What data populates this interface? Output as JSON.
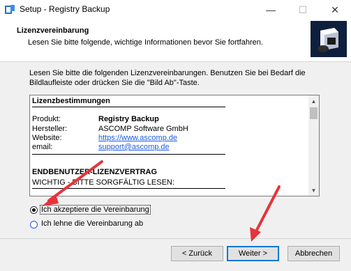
{
  "window": {
    "title": "Setup - Registry Backup",
    "minimize": "—",
    "maximize": "☐",
    "close": "✕"
  },
  "header": {
    "title": "Lizenzvereinbarung",
    "subtitle": "Lesen Sie bitte folgende, wichtige Informationen bevor Sie fortfahren."
  },
  "instructions": {
    "line1": "Lesen Sie bitte die folgenden Lizenzvereinbarungen. Benutzen Sie bei Bedarf die",
    "line2": "Bildlaufleiste oder drücken Sie die \"Bild Ab\"-Taste."
  },
  "license": {
    "heading": "Lizenzbestimmungen",
    "fields": [
      {
        "label": "Produkt:",
        "value": "Registry Backup",
        "bold": true
      },
      {
        "label": "Hersteller:",
        "value": "ASCOMP Software GmbH"
      },
      {
        "label": "Website:",
        "value": "https://www.ascomp.de",
        "link": true
      },
      {
        "label": "email:",
        "value": "support@ascomp.de",
        "link": true
      }
    ],
    "eula_heading": "ENDBENUTZER-LIZENZVERTRAG",
    "eula_sub": "WICHTIG - BITTE SORGFÄLTIG LESEN:"
  },
  "radios": {
    "accept": "Ich akzeptiere die Vereinbarung",
    "decline": "Ich lehne die Vereinbarung ab",
    "selected": "accept"
  },
  "buttons": {
    "back": "< Zurück",
    "next": "Weiter >",
    "cancel": "Abbrechen"
  },
  "colors": {
    "accent": "#0078d7",
    "link": "#1a5ce6",
    "annotation_arrow": "#e8333a"
  }
}
